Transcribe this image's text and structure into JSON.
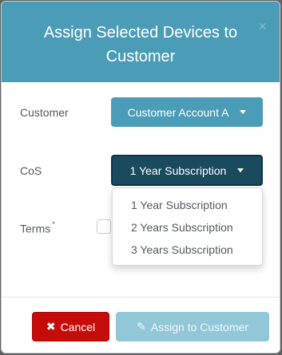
{
  "dialog": {
    "title": "Assign Selected Devices to Customer",
    "close_label": "×"
  },
  "form": {
    "customer_label": "Customer",
    "customer_value": "Customer Account A",
    "cos_label": "CoS",
    "cos_value": "1 Year Subscription",
    "cos_options": [
      "1 Year Subscription",
      "2 Years Subscription",
      "3 Years Subscription"
    ],
    "terms_label": "Terms",
    "terms_required_mark": "*"
  },
  "footer": {
    "cancel_label": "Cancel",
    "assign_label": "Assign to Customer"
  }
}
